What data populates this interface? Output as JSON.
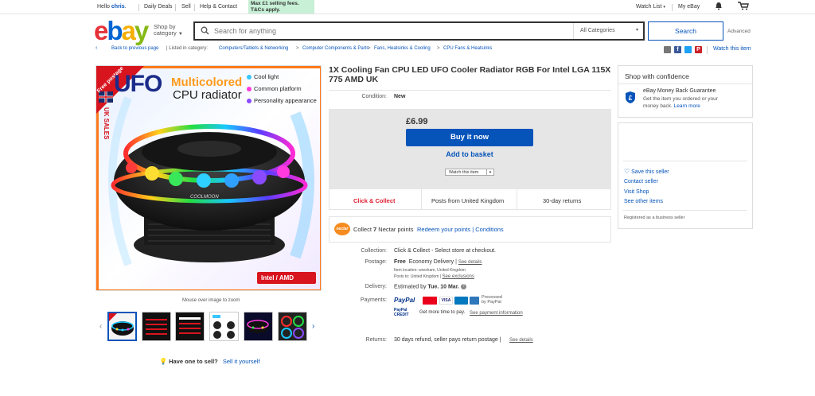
{
  "topbar": {
    "greeting_prefix": "Hello ",
    "user": "chris",
    "greeting_suffix": ".",
    "daily_deals": "Daily Deals",
    "sell": "Sell",
    "help": "Help & Contact",
    "promo_line1": "Max £1 selling fees.",
    "promo_line2": "T&Cs apply.",
    "watch_list": "Watch List",
    "my_ebay": "My eBay",
    "icons": [
      "bell-icon",
      "cart-icon"
    ]
  },
  "header": {
    "logo": [
      "e",
      "b",
      "a",
      "y"
    ],
    "shop_by_line1": "Shop by",
    "shop_by_line2": "category",
    "search_placeholder": "Search for anything",
    "category_select": "All Categories",
    "search_button": "Search",
    "advanced": "Advanced"
  },
  "breadcrumb": {
    "back": "Back to previous page",
    "listed_in": "| Listed in category:",
    "items": [
      "Computers/Tablets & Networking",
      "Computer Components & Parts",
      "Fans, Heatsinks & Cooling",
      "CPU Fans & Heatsinks"
    ],
    "separator": ">",
    "watch_this_item": "Watch this item"
  },
  "image": {
    "badge": "Free postage",
    "side_text": "UK SALES",
    "title_part": "UFO",
    "headline1": "Multicolored",
    "headline2": "CPU radiator",
    "bullets": [
      "Cool light",
      "Common platform",
      "Personality appearance"
    ],
    "brand_label": "COOLMOON",
    "platform": "Intel / AMD",
    "zoom_tip": "Mouse over image to zoom"
  },
  "product": {
    "title": "1X Cooling Fan CPU LED UFO Cooler Radiator RGB For Intel LGA 115X 775 AMD UK",
    "condition_label": "Condition:",
    "condition": "New",
    "price": "£6.99",
    "buy_now": "Buy it now",
    "add_to_basket": "Add to basket",
    "watch_button": "Watch this item",
    "features": [
      "Click & Collect",
      "Posts from United Kingdom",
      "30-day returns"
    ],
    "nectar_logo": "nectar",
    "nectar_text_pre": "Collect ",
    "nectar_points": "7",
    "nectar_text_post": " Nectar points",
    "nectar_redeem": "Redeem your points | Conditions",
    "collection_label": "Collection:",
    "collection": "Click & Collect - Select store at checkout.",
    "postage_label": "Postage:",
    "postage_free": "Free",
    "postage_service": "Economy Delivery",
    "postage_see": "See details",
    "item_location": "Item location:  wrexham, United Kingdom",
    "posts_to": "Posts to:  United Kingdom",
    "see_exclusions": "See exclusions",
    "delivery_label": "Delivery:",
    "delivery_pre": "Estimated by ",
    "delivery_date": "Tue. 10 Mar.",
    "payments_label": "Payments:",
    "paypal": "PayPal",
    "processed_by_line1": "Processed",
    "processed_by_line2": "by PayPal",
    "paypal_credit_line1": "PayPal",
    "paypal_credit_line2": "CREDIT",
    "more_time": "Get more time to pay.",
    "see_payment": "See payment information",
    "returns_label": "Returns:",
    "returns": "30 days refund, seller pays return postage |",
    "returns_see": "See details"
  },
  "thumbnails": [
    {
      "name": "thumbnail-1",
      "selected": true
    },
    {
      "name": "thumbnail-2",
      "selected": false
    },
    {
      "name": "thumbnail-3",
      "selected": false
    },
    {
      "name": "thumbnail-4",
      "selected": false
    },
    {
      "name": "thumbnail-5",
      "selected": false
    },
    {
      "name": "thumbnail-6",
      "selected": false
    }
  ],
  "confidence": {
    "heading": "Shop with confidence",
    "guarantee_title": "eBay Money Back Guarantee",
    "guarantee_line1": "Get the item you ordered or your",
    "guarantee_line2": "money back.",
    "learn_more": "Learn more"
  },
  "seller": {
    "save": "Save this seller",
    "contact": "Contact seller",
    "visit_shop": "Visit Shop",
    "other_items": "See other items",
    "business": "Registered as a business seller"
  },
  "sell_prompt": {
    "question": "Have one to sell?",
    "link": "Sell it yourself"
  },
  "colors": {
    "brand_blue": "#0654ba",
    "logo_red": "#e53238",
    "logo_blue": "#0064d2",
    "logo_yellow": "#f5af02",
    "logo_green": "#86b817",
    "click_collect_red": "#dd1e31",
    "promo_green": "#c7f0d6",
    "nectar_orange": "#f68b1f"
  }
}
